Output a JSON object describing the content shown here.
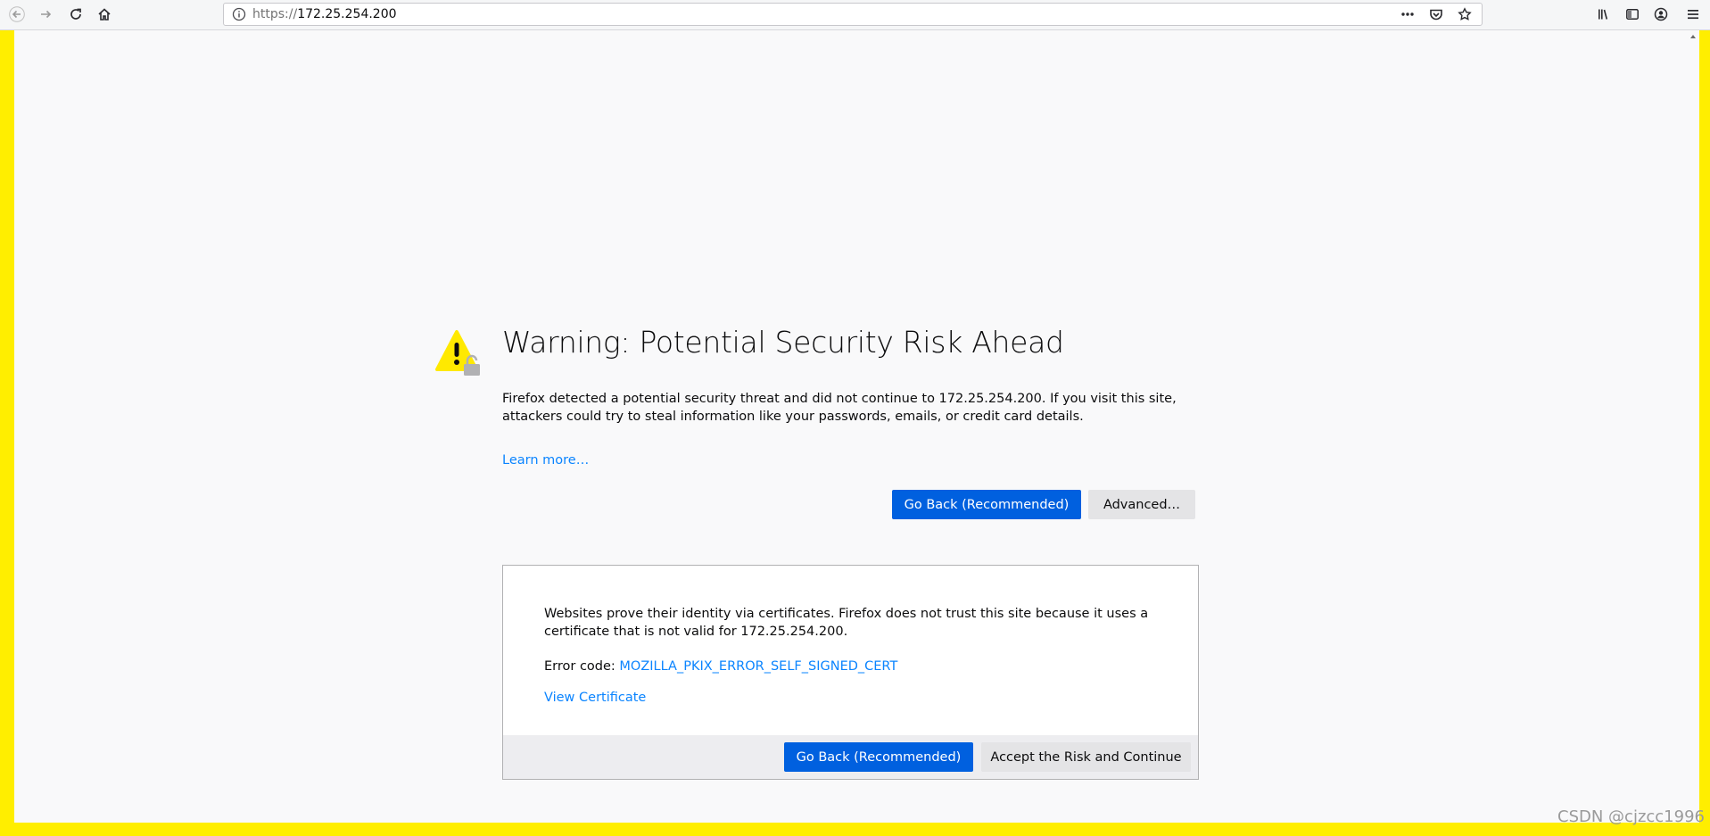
{
  "browser": {
    "url_scheme": "https://",
    "url_host": "172.25.254.200",
    "icons": {
      "back": "back-arrow-icon",
      "forward": "forward-arrow-icon",
      "reload": "reload-icon",
      "home": "home-icon",
      "site_info": "info-icon",
      "page_actions": "more-dots-icon",
      "pocket": "pocket-icon",
      "bookmark": "star-icon",
      "library": "library-icon",
      "sidebar": "sidebar-icon",
      "account": "account-icon",
      "menu": "hamburger-menu-icon"
    }
  },
  "error_page": {
    "title": "Warning: Potential Security Risk Ahead",
    "description": "Firefox detected a potential security threat and did not continue to 172.25.254.200. If you visit this site, attackers could try to steal information like your passwords, emails, or credit card details.",
    "learn_more": "Learn more…",
    "go_back_label": "Go Back (Recommended)",
    "advanced_label": "Advanced…",
    "advanced_panel": {
      "explanation": "Websites prove their identity via certificates. Firefox does not trust this site because it uses a certificate that is not valid for 172.25.254.200.",
      "error_code_label": "Error code: ",
      "error_code": "MOZILLA_PKIX_ERROR_SELF_SIGNED_CERT",
      "view_certificate": "View Certificate",
      "go_back_label": "Go Back (Recommended)",
      "accept_label": "Accept the Risk and Continue"
    }
  },
  "watermark": "CSDN @cjzcc1996",
  "colors": {
    "frame_border": "#ffee00",
    "primary_button": "#0060df",
    "link": "#0a84ff",
    "warning_yellow": "#ffe900"
  }
}
